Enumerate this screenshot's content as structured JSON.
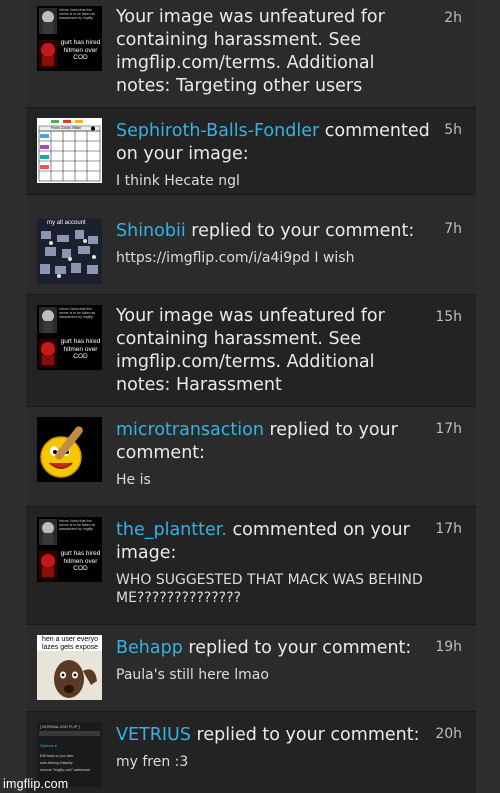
{
  "notifications": [
    {
      "thumbnail": "meme-thumbnail-dark-figure",
      "text": "Your image was unfeatured for containing harassment. See imgflip.com/terms. Additional notes: Targeting other users",
      "time": "2h"
    },
    {
      "thumbnail": "grid-chart-thumbnail",
      "user": "Sephiroth-Balls-Fondler",
      "action": "commented on your image:",
      "comment": "I think Hecate ngl",
      "time": "5h"
    },
    {
      "thumbnail": "collage-thumbnail",
      "user": "Shinobii",
      "action": "replied to your comment:",
      "comment": "https://imgflip.com/i/a4i9pd I wish",
      "time": "7h"
    },
    {
      "thumbnail": "meme-thumbnail-dark-figure",
      "text": "Your image was unfeatured for containing harassment. See imgflip.com/terms. Additional notes: Harassment",
      "time": "15h"
    },
    {
      "thumbnail": "emoji-bat-avatar",
      "user": "microtransaction",
      "action": "replied to your comment:",
      "comment": "He is",
      "time": "17h"
    },
    {
      "thumbnail": "meme-thumbnail-dark-figure",
      "user": "the_plantter.",
      "action": "commented on your image:",
      "comment": "WHO SUGGESTED THAT MACK WAS BEHIND ME??????????????",
      "time": "17h"
    },
    {
      "thumbnail": "shocked-man-meme",
      "user": "Behapp",
      "action": "replied to your comment:",
      "comment": "Paula's still here lmao",
      "time": "19h"
    },
    {
      "thumbnail": "screenshot-thumbnail",
      "user": "VETRIUS",
      "action": "replied to your comment:",
      "comment": "my fren :3",
      "time": "20h"
    }
  ],
  "thumbnail_text": {
    "meme_caption": "gurt has hired hitmen over COD",
    "meme_top_small": "Inform Vanio that this meme is to be taken as harassment by imgflip",
    "chart_header": "Fruits Colors Villain",
    "collage_caption": "my alt account",
    "shocked_caption": "hen a user everyo lazes gets expose",
    "screenshot_lines": [
      "[ NORMAL IMG FLIP ]",
      "Options ▾",
      "Edit facts on you item",
      "auto-flicking Instantly",
      "remove \"imgflip.com\" watermark"
    ]
  },
  "watermark": "imgflip.com",
  "colors": {
    "username": "#34b3e6",
    "text": "#eaeaea",
    "time": "#bdbdbd",
    "row_light": "#2b2b2b",
    "row_dark": "#232323"
  }
}
